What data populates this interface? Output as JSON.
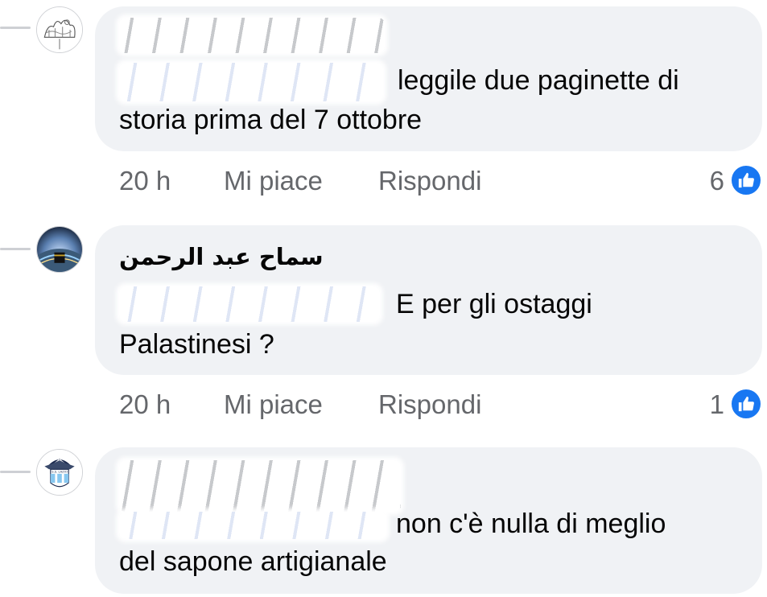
{
  "comments": [
    {
      "author": "",
      "mention": "",
      "text_lines": [
        "leggile due paginette di",
        "storia prima del 7 ottobre"
      ],
      "time": "20 h",
      "like_label": "Mi piace",
      "reply_label": "Rispondi",
      "reactions": "6",
      "avatar": "sketch-avatar"
    },
    {
      "author": "سماح عبد الرحمن",
      "mention": "",
      "text_lines": [
        "E per gli ostaggi",
        "Palastinesi ?"
      ],
      "time": "20 h",
      "like_label": "Mi piace",
      "reply_label": "Rispondi",
      "reactions": "1",
      "avatar": "mecca-night-avatar"
    },
    {
      "author": "",
      "mention": "",
      "text_lines": [
        "non c'è nulla di meglio",
        "del sapone artigianale"
      ],
      "avatar": "ss-lazio-badge-avatar"
    }
  ],
  "badge_text": "S.S. LAZIO",
  "colors": {
    "bubble": "#f0f2f5",
    "meta_text": "#65676b",
    "like_blue": "#1877f2",
    "thread_line": "#ced0d4"
  }
}
